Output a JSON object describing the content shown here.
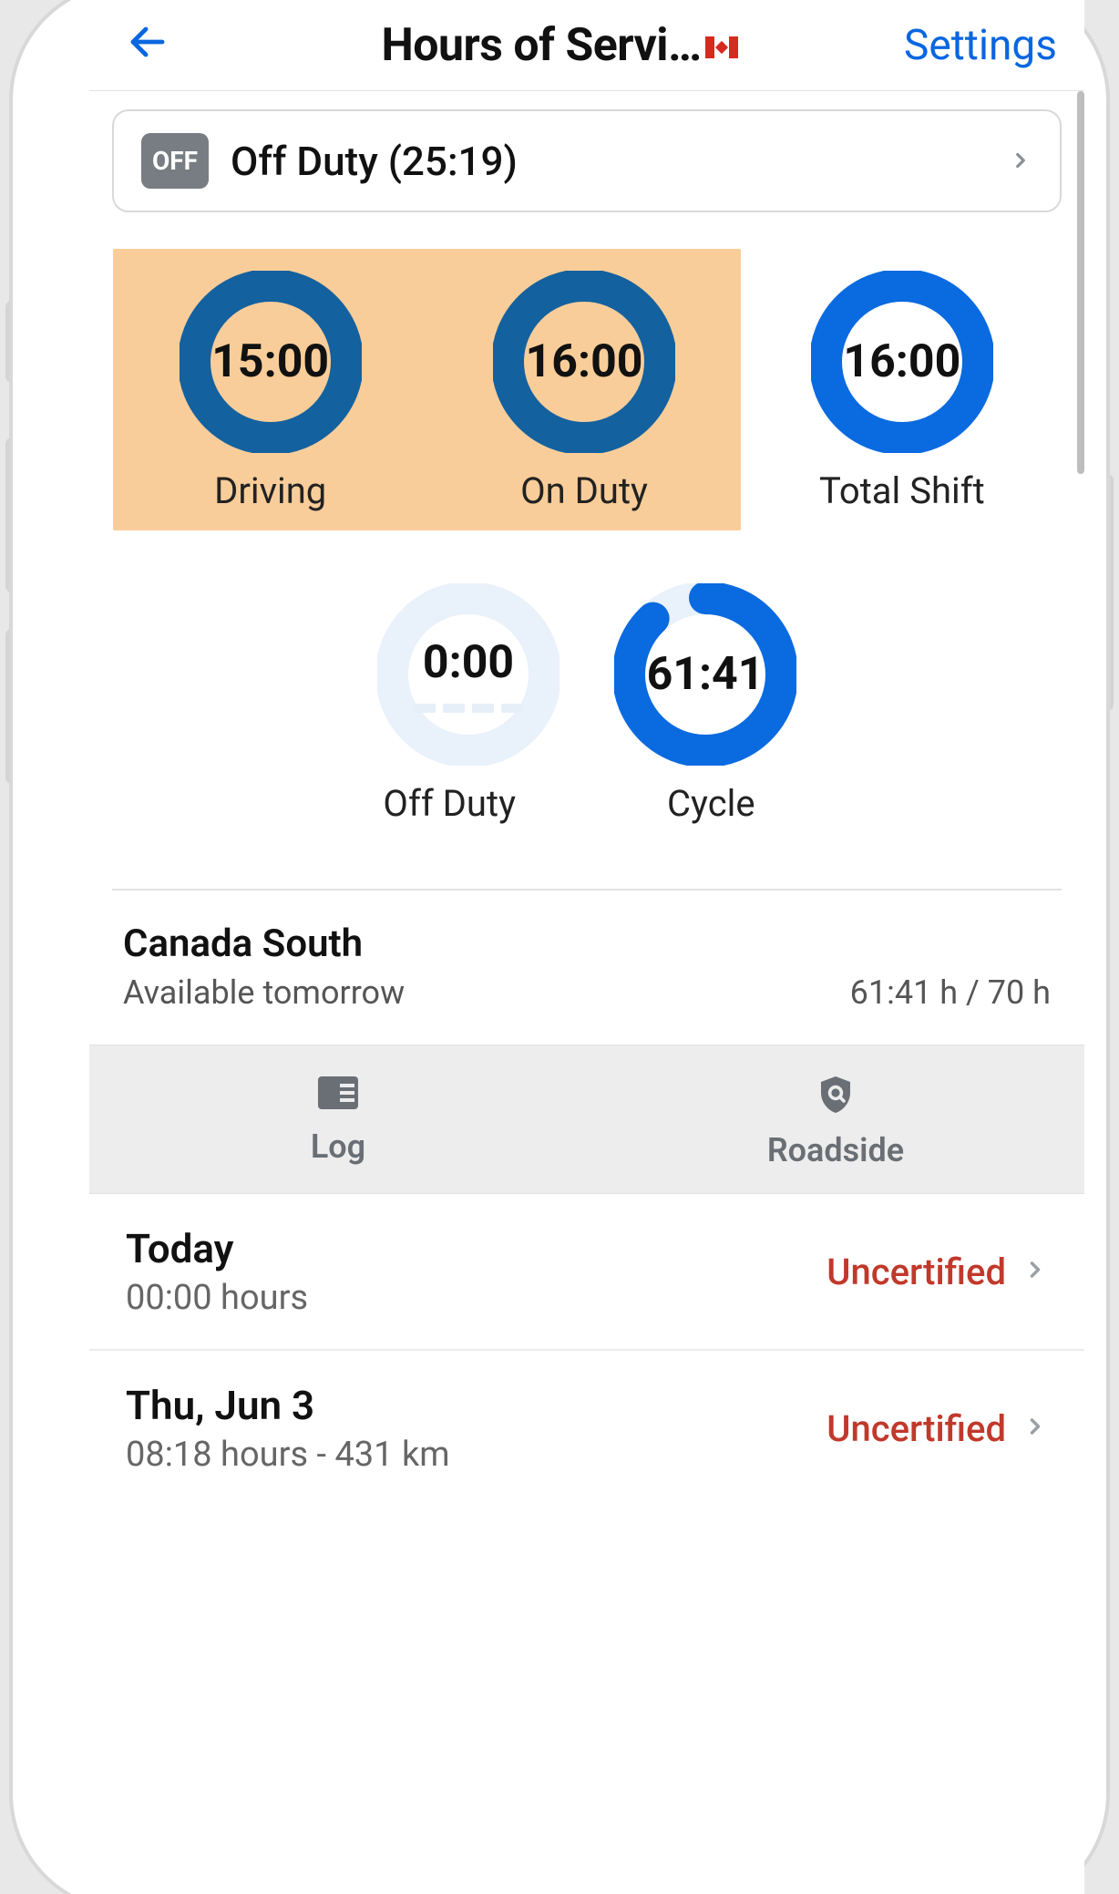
{
  "header": {
    "title": "Hours of Servi…",
    "settings": "Settings"
  },
  "status": {
    "badge": "OFF",
    "text": "Off Duty (25:19)"
  },
  "dials": {
    "driving": {
      "value": "15:00",
      "label": "Driving",
      "pct": 100,
      "color": "#14619f",
      "bg": "#f9cd99"
    },
    "onduty": {
      "value": "16:00",
      "label": "On Duty",
      "pct": 100,
      "color": "#14619f",
      "bg": "#f9cd99"
    },
    "total": {
      "value": "16:00",
      "label": "Total Shift",
      "pct": 100,
      "color": "#0a6ae0",
      "bg": "#ffffff"
    },
    "offduty": {
      "value": "0:00",
      "label": "Off Duty",
      "pct": 0,
      "color": "#0a6ae0",
      "bg": "#e9f1fb"
    },
    "cycle": {
      "value": "61:41",
      "label": "Cycle",
      "pct": 88,
      "color": "#0a6ae0",
      "bg": "#e9f1fb"
    }
  },
  "region": {
    "name": "Canada South",
    "subtitle": "Available tomorrow",
    "hours": "61:41 h / 70 h"
  },
  "tabs": {
    "log": "Log",
    "roadside": "Roadside"
  },
  "logs": [
    {
      "title": "Today",
      "subtitle": "00:00 hours",
      "status": "Uncertified"
    },
    {
      "title": "Thu, Jun 3",
      "subtitle": "08:18 hours - 431 km",
      "status": "Uncertified"
    }
  ]
}
